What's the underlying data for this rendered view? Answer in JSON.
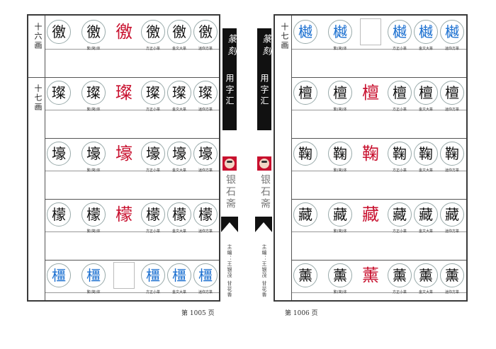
{
  "left_page": {
    "sections": [
      {
        "label": "十六画"
      },
      {
        "label": "十七画"
      }
    ],
    "rows": [
      {
        "regular": "徼",
        "traditional": "徼",
        "seal_red": "徼",
        "xiaozhuan": "徼",
        "dazhuan": "徼",
        "miniseal": "徼",
        "color": "black",
        "has_seal": true
      },
      {
        "regular": "璨",
        "traditional": "璨",
        "seal_red": "璨",
        "xiaozhuan": "璨",
        "dazhuan": "璨",
        "miniseal": "璨",
        "color": "black",
        "has_seal": true
      },
      {
        "regular": "壕",
        "traditional": "壕",
        "seal_red": "壕",
        "xiaozhuan": "壕",
        "dazhuan": "壕",
        "miniseal": "壕",
        "color": "black",
        "has_seal": true
      },
      {
        "regular": "檬",
        "traditional": "檬",
        "seal_red": "檬",
        "xiaozhuan": "檬",
        "dazhuan": "檬",
        "miniseal": "檬",
        "color": "black",
        "has_seal": true
      },
      {
        "regular": "橿",
        "traditional": "橿",
        "seal_red": "",
        "xiaozhuan": "橿",
        "dazhuan": "橿",
        "miniseal": "橿",
        "color": "blue",
        "has_seal": false
      }
    ],
    "captions": {
      "traditional": "繁(简)体",
      "xiaozhuan": "方正小篆",
      "dazhuan": "金文大篆",
      "miniseal": "迷你方篆"
    },
    "page_number": "第 1005 页"
  },
  "right_page": {
    "sections": [
      {
        "label": "十七画"
      }
    ],
    "rows": [
      {
        "regular": "樾",
        "traditional": "樾",
        "seal_red": "",
        "xiaozhuan": "樾",
        "dazhuan": "樾",
        "miniseal": "樾",
        "color": "blue",
        "has_seal": false
      },
      {
        "regular": "檀",
        "traditional": "檀",
        "seal_red": "檀",
        "xiaozhuan": "檀",
        "dazhuan": "檀",
        "miniseal": "檀",
        "color": "black",
        "has_seal": true
      },
      {
        "regular": "鞠",
        "traditional": "鞠",
        "seal_red": "鞠",
        "xiaozhuan": "鞠",
        "dazhuan": "鞠",
        "miniseal": "鞠",
        "color": "black",
        "has_seal": true
      },
      {
        "regular": "藏",
        "traditional": "藏",
        "seal_red": "藏",
        "xiaozhuan": "藏",
        "dazhuan": "藏",
        "miniseal": "藏",
        "color": "black",
        "has_seal": true
      },
      {
        "regular": "薰",
        "traditional": "薰",
        "seal_red": "薰",
        "xiaozhuan": "薰",
        "dazhuan": "薰",
        "miniseal": "薰",
        "color": "black",
        "has_seal": true
      }
    ],
    "captions": {
      "traditional": "繁(简)体",
      "xiaozhuan": "方正小篆",
      "dazhuan": "金文大篆",
      "miniseal": "迷你方篆"
    },
    "page_number": "第 1006 页"
  },
  "spine": {
    "title_calli": "篆刻",
    "title": "用字汇",
    "press": "银石斋",
    "editor": "主编：王银茂  甘花香"
  },
  "colors": {
    "seal_red": "#c8102e",
    "blue": "#1a6fd0",
    "spine": "#111111"
  }
}
